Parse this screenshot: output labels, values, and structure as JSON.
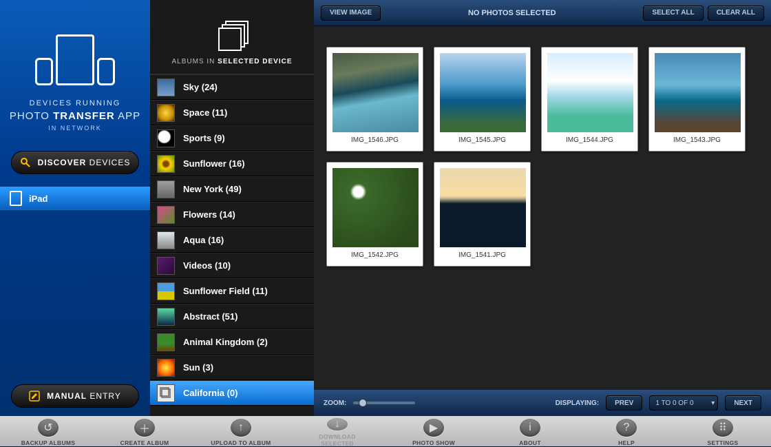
{
  "sidebar": {
    "running_label": "DEVICES RUNNING",
    "app_title_a": "PHOTO ",
    "app_title_b": "TRANSFER",
    "app_title_c": " APP",
    "in_network": "IN NETWORK",
    "discover_a": "DISCOVER",
    "discover_b": " DEVICES",
    "manual_a": "MANUAL",
    "manual_b": " ENTRY",
    "device": "iPad"
  },
  "albums_header": {
    "a": "ALBUMS IN ",
    "b": "SELECTED DEVICE"
  },
  "albums": [
    {
      "name": "Sky (24)",
      "bg": "linear-gradient(#3b6aa0,#7aa0c8)"
    },
    {
      "name": "Space (11)",
      "bg": "radial-gradient(circle,#ffd54a,#c88f00 60%,#3a2200)"
    },
    {
      "name": "Sports (9)",
      "bg": "radial-gradient(circle at 40% 40%,#ffffff 40%,#000000 50%)"
    },
    {
      "name": "Sunflower (16)",
      "bg": "radial-gradient(circle,#7a4a00 20%,#ffd000 40%,#648b00)"
    },
    {
      "name": "New York (49)",
      "bg": "linear-gradient(#a0a0a0,#666)"
    },
    {
      "name": "Flowers (14)",
      "bg": "linear-gradient(135deg,#d84a8a,#5a8b2d)"
    },
    {
      "name": "Aqua (16)",
      "bg": "linear-gradient(#dde8ec,#888)"
    },
    {
      "name": "Videos (10)",
      "bg": "linear-gradient(135deg,#5a1a6a,#2a0a3a)"
    },
    {
      "name": "Sunflower Field (11)",
      "bg": "linear-gradient(#4a9dd8 50%,#d8c800 50%)"
    },
    {
      "name": "Abstract (51)",
      "bg": "linear-gradient(#5ad8a0,#0a2a4a)"
    },
    {
      "name": "Animal Kingdom (2)",
      "bg": "linear-gradient(#3a8a2a 60%,#6a4a0a)"
    },
    {
      "name": "Sun (3)",
      "bg": "radial-gradient(circle,#ffec4a,#ff6a00 60%,#8a1a00)"
    },
    {
      "name": "California (0)",
      "selected": true,
      "icon": true
    }
  ],
  "toolbar": {
    "view": "VIEW IMAGE",
    "status": "NO PHOTOS SELECTED",
    "select_all": "SELECT ALL",
    "clear_all": "CLEAR ALL"
  },
  "photos": [
    {
      "label": "IMG_1546.JPG",
      "bg": "linear-gradient(170deg,#4a5a44 0%,#6a7a5a 25%,#1a4a5a 45%,#6ab9cc 60%,#4a8aa0 100%)"
    },
    {
      "label": "IMG_1545.JPG",
      "bg": "linear-gradient(180deg,#b8d4ee 0%,#4a9acc 40%,#0a5a8a 60%,#3a6a3a 90%)"
    },
    {
      "label": "IMG_1544.JPG",
      "bg": "linear-gradient(180deg,#d8eefd 0%,#ffffff 35%,#a0d8e8 55%,#4aba9a 80%)"
    },
    {
      "label": "IMG_1543.JPG",
      "bg": "linear-gradient(180deg,#4a8ab8 0%,#6ab8d6 40%,#0a6a8a 60%,#5a4430 90%)"
    },
    {
      "label": "IMG_1542.JPG",
      "bg": "radial-gradient(circle at 30% 30%,#ffffff 6%,#3a6a2a 10%,#2a4a1a 80%)"
    },
    {
      "label": "IMG_1541.JPG",
      "bg": "linear-gradient(180deg,#ead8b0 0%,#f8dca0 35%,#c8b898 38%,#0a1a2a 45%,#0a1a2a 100%)"
    }
  ],
  "bottom": {
    "zoom": "ZOOM:",
    "displaying": "DISPLAYING:",
    "prev": "PREV",
    "pager": "1 TO 0 OF 0",
    "next": "NEXT"
  },
  "footer": [
    {
      "label": "BACKUP ALBUMS",
      "glyph": "↺"
    },
    {
      "label": "CREATE ALBUM",
      "glyph": "＋"
    },
    {
      "label": "UPLOAD TO ALBUM",
      "glyph": "↑"
    },
    {
      "label": "DOWNLOAD SELECTED",
      "glyph": "↓",
      "disabled": true
    },
    {
      "label": "PHOTO SHOW",
      "glyph": "▶"
    },
    {
      "label": "ABOUT",
      "glyph": "i"
    },
    {
      "label": "HELP",
      "glyph": "?"
    },
    {
      "label": "SETTINGS",
      "glyph": "⠿"
    }
  ]
}
